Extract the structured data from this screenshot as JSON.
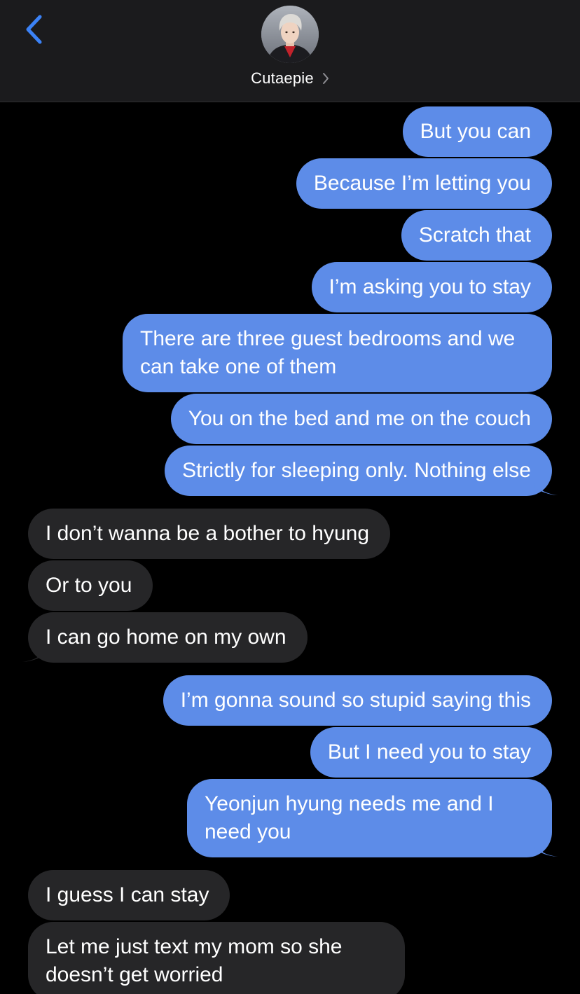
{
  "header": {
    "contact_name": "Cutaepie",
    "back_icon": "chevron-left-icon",
    "details_icon": "chevron-right-icon"
  },
  "colors": {
    "sent_bubble": "#5d8ce8",
    "received_bubble": "#262628",
    "header_bg": "#1b1b1d",
    "accent": "#3b82f6"
  },
  "messages": [
    {
      "dir": "sent",
      "text": "But you can"
    },
    {
      "dir": "sent",
      "text": "Because I’m letting you"
    },
    {
      "dir": "sent",
      "text": "Scratch that"
    },
    {
      "dir": "sent",
      "text": "I’m asking you to stay"
    },
    {
      "dir": "sent",
      "text": "There are three guest bedrooms and we can take one of them"
    },
    {
      "dir": "sent",
      "text": "You on the bed and me on the couch"
    },
    {
      "dir": "sent",
      "text": "Strictly for sleeping only. Nothing else"
    },
    {
      "dir": "received",
      "text": "I don’t wanna be a bother to hyung"
    },
    {
      "dir": "received",
      "text": "Or to you"
    },
    {
      "dir": "received",
      "text": "I can go home on my own"
    },
    {
      "dir": "sent",
      "text": "I’m gonna sound so stupid saying this"
    },
    {
      "dir": "sent",
      "text": "But I need you to stay"
    },
    {
      "dir": "sent",
      "text": "Yeonjun hyung needs me and I need you"
    },
    {
      "dir": "received",
      "text": "I guess I can stay"
    },
    {
      "dir": "received",
      "text": "Let me just text my mom so she doesn’t get worried"
    }
  ]
}
